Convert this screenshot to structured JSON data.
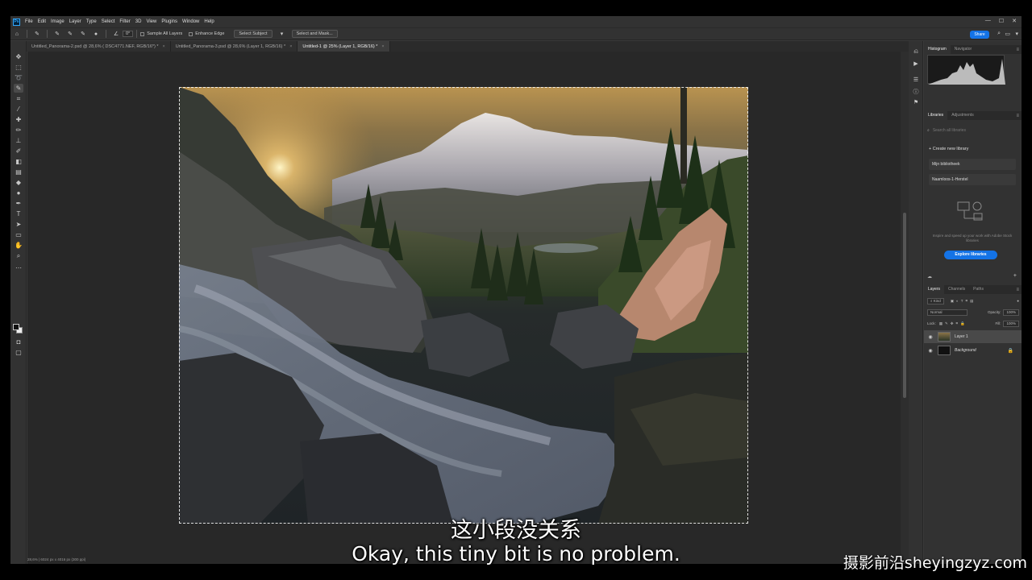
{
  "menu": {
    "logo": "Ps",
    "items": [
      "File",
      "Edit",
      "Image",
      "Layer",
      "Type",
      "Select",
      "Filter",
      "3D",
      "View",
      "Plugins",
      "Window",
      "Help"
    ]
  },
  "options": {
    "angle": "0°",
    "sample_all_layers": "Sample All Layers",
    "enhance_edge": "Enhance Edge",
    "select_subject": "Select Subject",
    "select_and_mask": "Select and Mask...",
    "share": "Share"
  },
  "tabs": [
    {
      "label": "Untitled_Panorama-2.psd @ 28,6% ( DSC4771.NEF, RGB/16*) *"
    },
    {
      "label": "Untitled_Panorama-3.psd @ 28,6% (Layer 1, RGB/16) *"
    },
    {
      "label": "Untitled-1 @ 25% (Layer 1, RGB/16) *"
    }
  ],
  "panels": {
    "histogram_tabs": [
      "Histogram",
      "Navigator"
    ],
    "libraries_tabs": [
      "Libraries",
      "Adjustments"
    ],
    "search_placeholder": "Search all libraries",
    "create_library": "Create new library",
    "library_items": [
      "Mijn bibliotheek",
      "Naamloos-1-Herstel"
    ],
    "libraries_text": "Inspire and speed up your work with Adobe Stock libraries",
    "explore_button": "Explore libraries",
    "layers_tabs": [
      "Layers",
      "Channels",
      "Paths"
    ],
    "kind": "Kind",
    "blend_mode": "Normal",
    "opacity_label": "Opacity:",
    "opacity_value": "100%",
    "lock_label": "Lock:",
    "fill_label": "Fill:",
    "fill_value": "100%",
    "layers": [
      {
        "name": "Layer 1"
      },
      {
        "name": "Background"
      }
    ]
  },
  "status": "28,6%  |  6024 px x 4016 px (300 ppi)",
  "subtitles": {
    "cn": "这小段没关系",
    "en": "Okay, this tiny bit is no problem."
  },
  "watermark": "摄影前沿sheyingzyz.com",
  "colors": {
    "accent": "#1473e6",
    "app_bg": "#323232",
    "canvas_bg": "#282828"
  }
}
